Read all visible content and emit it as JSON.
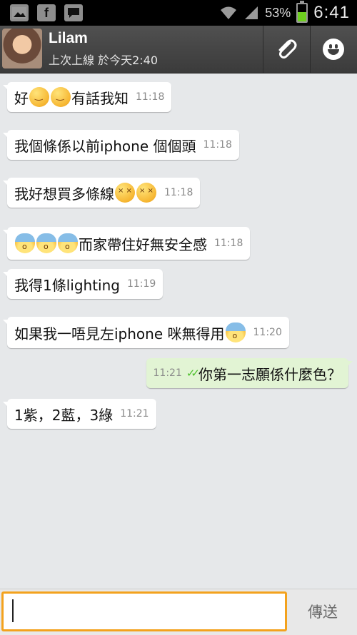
{
  "statusbar": {
    "notification_icons": [
      "gallery-icon",
      "facebook-icon",
      "chat-icon"
    ],
    "facebook_glyph": "f",
    "battery_percent": "53%",
    "battery_level": 0.53,
    "time": "6:41",
    "battery_color": "#6ed01f"
  },
  "header": {
    "contact_name": "Lilam",
    "last_seen": "上次上線 於今天2:40",
    "attach_icon": "paperclip-icon",
    "emoji_icon": "smiley-icon"
  },
  "messages": [
    {
      "direction": "in",
      "parts": [
        "好",
        "blush-emoji",
        "blush-emoji",
        "有話我知"
      ],
      "text_a": "好",
      "text_b": "有話我知",
      "time": "11:18"
    },
    {
      "direction": "in",
      "text": "我個條係以前iphone 個個頭",
      "time": "11:18"
    },
    {
      "direction": "in",
      "text": "我好想買多條線",
      "emojis": [
        "tired-emoji",
        "tired-emoji"
      ],
      "time": "11:18"
    },
    {
      "direction": "in",
      "emojis": [
        "fearful-emoji",
        "fearful-emoji",
        "fearful-emoji"
      ],
      "text": "而家帶住好無安全感",
      "time": "11:18"
    },
    {
      "direction": "in",
      "text": "我得1條lighting",
      "time": "11:19"
    },
    {
      "direction": "in",
      "text": "如果我一唔見左iphone 咪無得用",
      "emojis": [
        "fearful-emoji"
      ],
      "time": "11:20"
    },
    {
      "direction": "out",
      "text": "你第一志願係什麼色？",
      "time": "11:21",
      "status": "read",
      "status_glyph": "✓✓"
    },
    {
      "direction": "in",
      "text": "1紫，2藍，3綠",
      "time": "11:21"
    }
  ],
  "composer": {
    "input_value": "",
    "send_label": "傳送",
    "accent_color": "#f3a21d"
  }
}
